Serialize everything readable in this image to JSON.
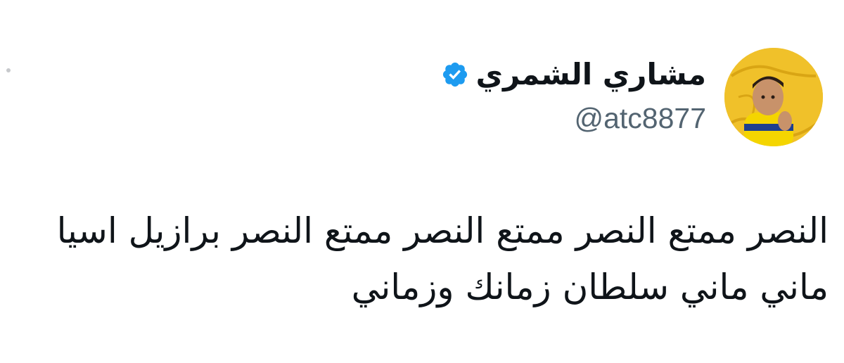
{
  "tweet": {
    "author": {
      "display_name": "مشاري الشمري",
      "handle": "@atc8877",
      "verified": true,
      "avatar": "avatar-photo-child-yellow-shirt"
    },
    "text_lines": [
      "النصر ممتع النصر ممتع النصر ممتع النصر برازيل اسيا",
      "ماني ماني سلطان زمانك وزماني"
    ],
    "icons": {
      "more": "more-dots-icon",
      "verified": "verified-badge-icon"
    },
    "colors": {
      "verified_blue": "#1d9bf0",
      "handle_gray": "#536471",
      "text": "#0f1419",
      "avatar_bg": "#f0c12a"
    }
  }
}
